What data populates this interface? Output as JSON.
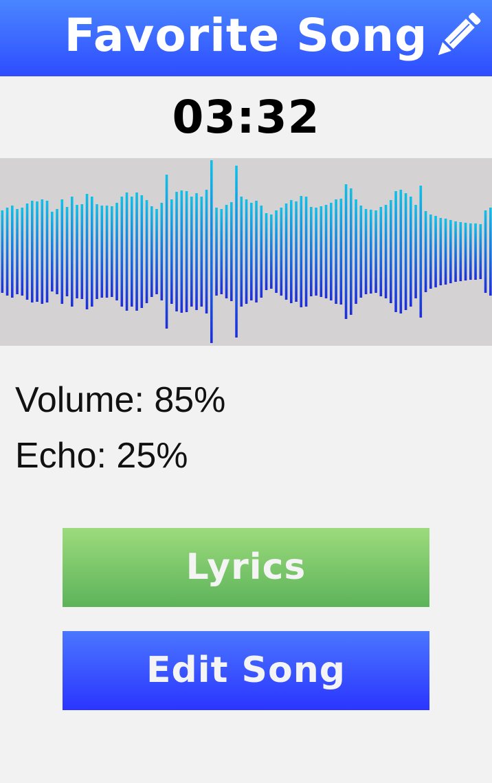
{
  "header": {
    "title": "Favorite Song",
    "edit_icon": "pencil-icon"
  },
  "player": {
    "time": "03:32"
  },
  "waveform": {
    "icon": "audio-waveform",
    "gradient_top": "#12c0e6",
    "gradient_bottom": "#1e2ed8",
    "background": "#d4d2d3"
  },
  "settings": {
    "volume_label": "Volume: 85%",
    "echo_label": "Echo: 25%"
  },
  "buttons": {
    "lyrics_label": "Lyrics",
    "edit_label": "Edit Song"
  },
  "colors": {
    "header_top": "#4a86ff",
    "header_bottom": "#2e4dff",
    "lyrics_top": "#9cdb7c",
    "lyrics_bottom": "#5db35a",
    "edit_top": "#4a76ff",
    "edit_bottom": "#2b35ff"
  }
}
